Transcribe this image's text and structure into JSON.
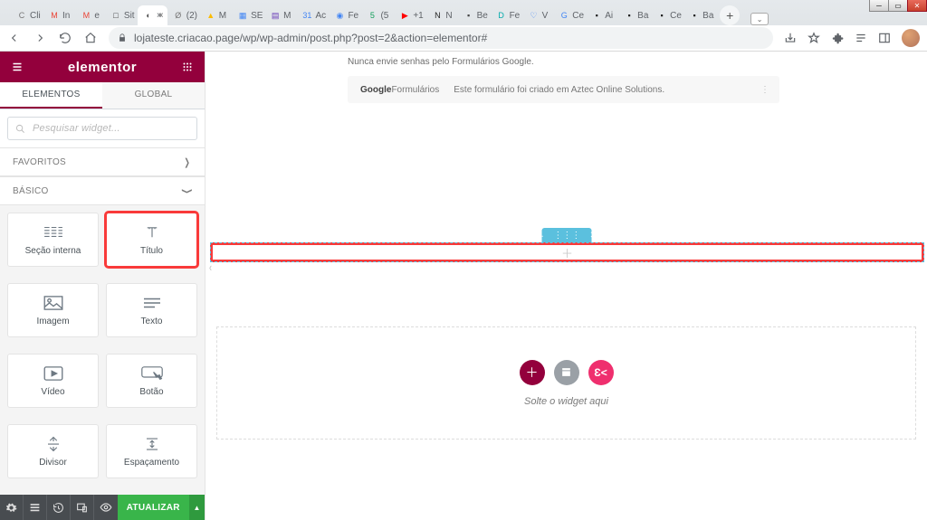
{
  "browser": {
    "tabs": [
      {
        "icon": "C",
        "label": "Cli",
        "color": "#777"
      },
      {
        "icon": "M",
        "label": "In",
        "color": "#ea4335"
      },
      {
        "icon": "M",
        "label": "e",
        "color": "#ea4335"
      },
      {
        "icon": "□",
        "label": "Sit",
        "color": "#333"
      },
      {
        "icon": "◐",
        "label": "×",
        "color": "#555",
        "active": true
      },
      {
        "icon": "Ø",
        "label": "(2)",
        "color": "#777"
      },
      {
        "icon": "▲",
        "label": "M",
        "color": "#fbbc04"
      },
      {
        "icon": "▦",
        "label": "SE",
        "color": "#4285f4"
      },
      {
        "icon": "▤",
        "label": "M",
        "color": "#673ab7"
      },
      {
        "icon": "31",
        "label": "Ac",
        "color": "#4285f4"
      },
      {
        "icon": "◉",
        "label": "Fe",
        "color": "#4285f4"
      },
      {
        "icon": "5",
        "label": "(5",
        "color": "#0f9d58"
      },
      {
        "icon": "▶",
        "label": "+1",
        "color": "#ff0000"
      },
      {
        "icon": "N",
        "label": "N",
        "color": "#222"
      },
      {
        "icon": "▪",
        "label": "Be",
        "color": "#444"
      },
      {
        "icon": "D",
        "label": "Fe",
        "color": "#0aa"
      },
      {
        "icon": "♡",
        "label": "V",
        "color": "#4285f4"
      },
      {
        "icon": "G",
        "label": "Ce",
        "color": "#4285f4"
      },
      {
        "icon": "▪",
        "label": "Ai",
        "color": "#222"
      },
      {
        "icon": "▪",
        "label": "Ba",
        "color": "#222"
      },
      {
        "icon": "▪",
        "label": "Ce",
        "color": "#222"
      },
      {
        "icon": "▪",
        "label": "Ba",
        "color": "#222"
      }
    ],
    "url": "lojateste.criacao.page/wp/wp-admin/post.php?post=2&action=elementor#"
  },
  "panel": {
    "logo": "elementor",
    "tabs": {
      "elements": "ELEMENTOS",
      "global": "GLOBAL"
    },
    "search_placeholder": "Pesquisar widget...",
    "categories": {
      "favoritos": "FAVORITOS",
      "basico": "BÁSICO"
    },
    "widgets": [
      {
        "key": "secao",
        "label": "Seção interna"
      },
      {
        "key": "titulo",
        "label": "Título",
        "hl": true
      },
      {
        "key": "imagem",
        "label": "Imagem"
      },
      {
        "key": "texto",
        "label": "Texto"
      },
      {
        "key": "video",
        "label": "Vídeo"
      },
      {
        "key": "botao",
        "label": "Botão"
      },
      {
        "key": "divisor",
        "label": "Divisor"
      },
      {
        "key": "espacamento",
        "label": "Espaçamento"
      }
    ],
    "footer_button": "ATUALIZAR"
  },
  "canvas": {
    "google_note": "Nunca envie senhas pelo Formulários Google.",
    "google_brand": "Google",
    "google_product": "Formulários",
    "google_byline": "Este formulário foi criado em Aztec Online Solutions.",
    "drop_label": "Solte o widget aqui",
    "pink_ek": "Ɛ<"
  }
}
